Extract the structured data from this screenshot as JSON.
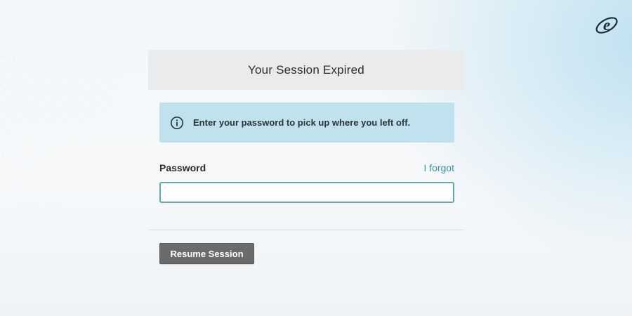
{
  "header": {
    "title": "Your Session Expired"
  },
  "info": {
    "icon": "info-icon",
    "message": "Enter your password to pick up where you left off."
  },
  "form": {
    "password_label": "Password",
    "forgot_link": "I forgot",
    "password_value": "",
    "password_placeholder": ""
  },
  "actions": {
    "resume_label": "Resume Session"
  },
  "branding": {
    "logo_icon": "e-logo-icon"
  },
  "colors": {
    "accent": "#3a93a8",
    "info_background": "#bfe2ee",
    "input_border": "#5fa9b4",
    "button_background": "#6b6b6b",
    "header_background": "#e9ebed"
  }
}
